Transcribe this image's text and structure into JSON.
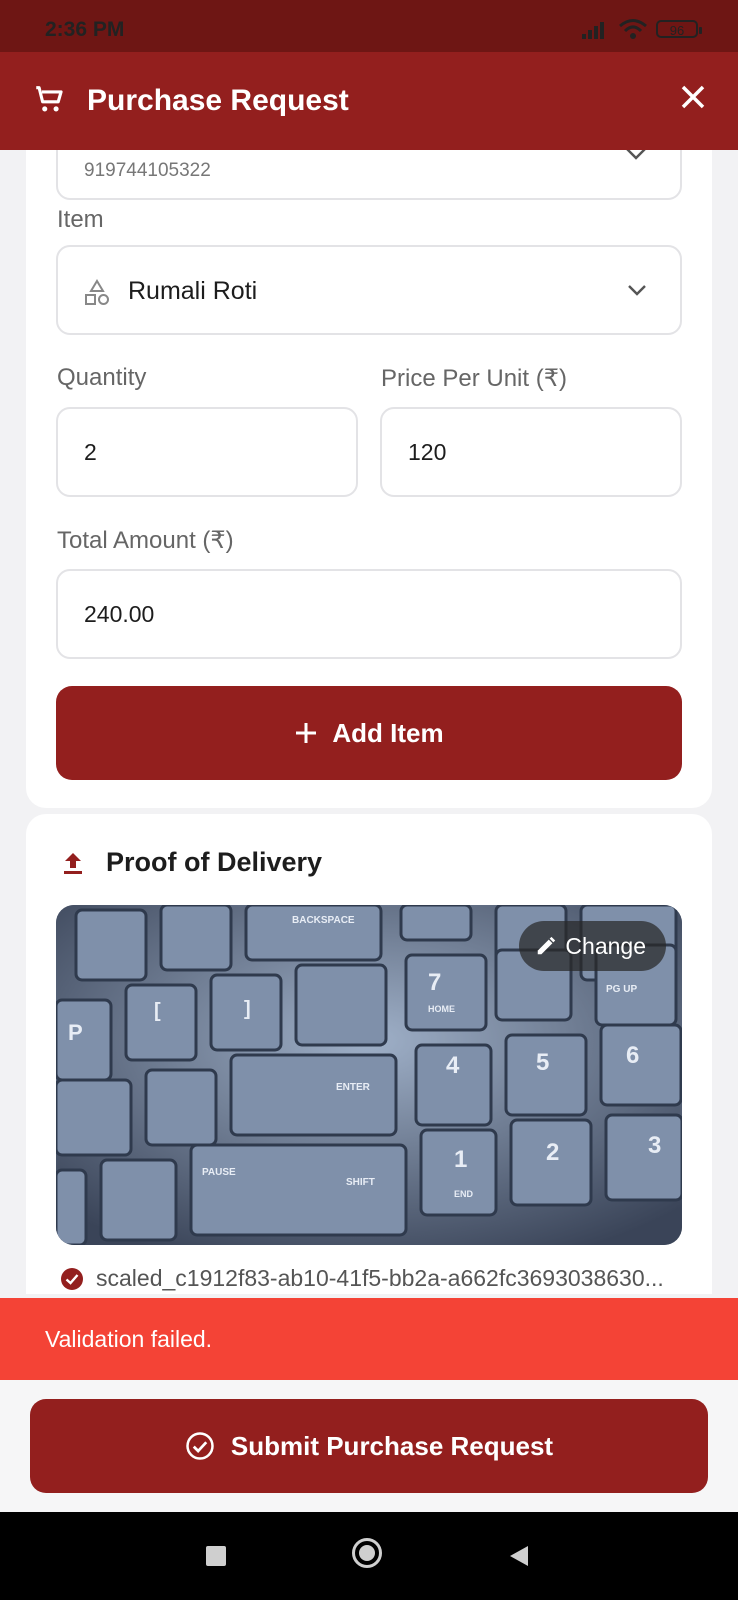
{
  "status_bar": {
    "time": "2:36 PM",
    "battery": "96"
  },
  "app_bar": {
    "title": "Purchase Request",
    "icon": "cart-icon",
    "close_icon": "close-icon"
  },
  "form": {
    "phone_value": "919744105322",
    "item": {
      "label": "Item",
      "value": "Rumali Roti"
    },
    "quantity": {
      "label": "Quantity",
      "value": "2"
    },
    "price": {
      "label": "Price Per Unit (₹)",
      "value": "120"
    },
    "total": {
      "label": "Total Amount (₹)",
      "value": "240.00"
    },
    "add_item_label": "Add Item"
  },
  "proof": {
    "title": "Proof of Delivery",
    "change_label": "Change",
    "filename": "scaled_c1912f83-ab10-41f5-bb2a-a662fc3693038630..."
  },
  "snackbar": {
    "message": "Validation failed."
  },
  "submit_label": "Submit Purchase Request",
  "colors": {
    "primary": "#931f1e",
    "status_bar": "#6e1614",
    "error": "#f44336"
  }
}
